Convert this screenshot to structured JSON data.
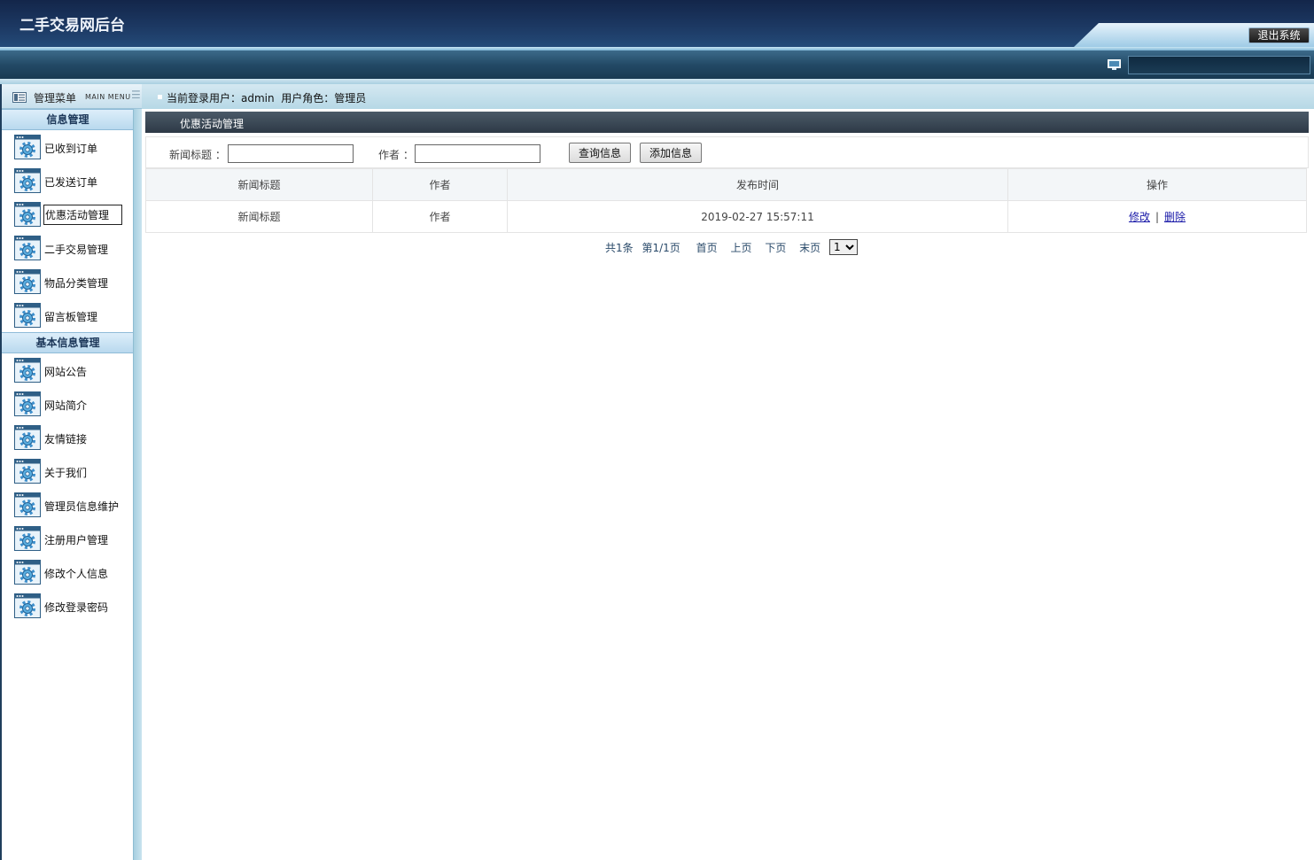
{
  "header": {
    "app_title": "二手交易网后台",
    "logout_label": "退出系统"
  },
  "sidebar": {
    "title": "管理菜单",
    "subtitle": "MAIN MENU",
    "groups": [
      {
        "label": "信息管理",
        "items": [
          "已收到订单",
          "已发送订单",
          "优惠活动管理",
          "二手交易管理",
          "物品分类管理",
          "留言板管理"
        ]
      },
      {
        "label": "基本信息管理",
        "items": [
          "网站公告",
          "网站简介",
          "友情链接",
          "关于我们",
          "管理员信息维护",
          "注册用户管理",
          "修改个人信息",
          "修改登录密码"
        ]
      }
    ],
    "active_item": "优惠活动管理"
  },
  "status": {
    "text": "当前登录用户：admin  用户角色：管理员"
  },
  "panel": {
    "title": "优惠活动管理",
    "search": {
      "title_label": "新闻标题 ：",
      "title_value": "",
      "author_label": "作者 ：",
      "author_value": "",
      "query_button": "查询信息",
      "add_button": "添加信息"
    },
    "table": {
      "headers": [
        "新闻标题",
        "作者",
        "发布时间",
        "操作"
      ],
      "rows": [
        {
          "title": "新闻标题",
          "author": "作者",
          "time": "2019-02-27 15:57:11",
          "edit": "修改",
          "sep": "|",
          "delete": "删除"
        }
      ]
    },
    "pager": {
      "total": "共1条",
      "page_info": "第1/1页",
      "first": "首页",
      "prev": "上页",
      "next": "下页",
      "last": "末页",
      "selected_page": "1"
    }
  },
  "colors": {
    "header_dark": "#13264a",
    "accent_light": "#b6d8e6",
    "panel_title": "#2d3946",
    "link": "#1a1aa8"
  }
}
